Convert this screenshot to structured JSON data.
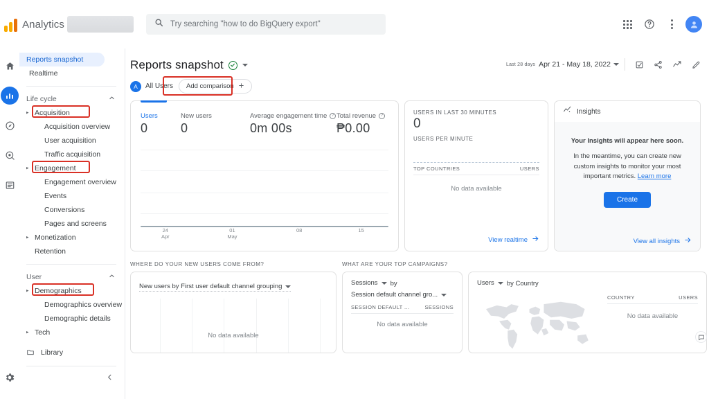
{
  "topbar": {
    "brand_name": "Analytics",
    "logo_icon": "analytics-bars-icon",
    "property_chip": "",
    "search": {
      "placeholder": "Try searching \"how to do BigQuery export\"",
      "value": "",
      "icon": "search-icon"
    },
    "icons": {
      "apps": "apps-grid-icon",
      "help": "help-circle-icon",
      "more": "kebab-menu-icon",
      "account": "account-avatar-icon"
    }
  },
  "rail": {
    "items": [
      {
        "name": "home",
        "icon": "home-icon",
        "active": false
      },
      {
        "name": "reports",
        "icon": "bar-chart-icon",
        "active": true
      },
      {
        "name": "explore",
        "icon": "explore-icon",
        "active": false
      },
      {
        "name": "advertising",
        "icon": "advertising-icon",
        "active": false
      },
      {
        "name": "configure",
        "icon": "list-icon",
        "active": false
      }
    ],
    "settings_icon": "gear-icon"
  },
  "sidebar": {
    "top_items": [
      {
        "label": "Reports snapshot",
        "selected": true
      },
      {
        "label": "Realtime",
        "selected": false
      }
    ],
    "groups": [
      {
        "title": "Life cycle",
        "collapse_icon": "chevron-up-icon",
        "items": [
          {
            "label": "Acquisition",
            "level": 1,
            "expandable": true,
            "highlighted": true
          },
          {
            "label": "Acquisition overview",
            "level": 2,
            "expandable": false,
            "highlighted": false
          },
          {
            "label": "User acquisition",
            "level": 2,
            "expandable": false,
            "highlighted": false
          },
          {
            "label": "Traffic acquisition",
            "level": 2,
            "expandable": false,
            "highlighted": false
          },
          {
            "label": "Engagement",
            "level": 1,
            "expandable": true,
            "highlighted": true
          },
          {
            "label": "Engagement overview",
            "level": 2,
            "expandable": false,
            "highlighted": false
          },
          {
            "label": "Events",
            "level": 2,
            "expandable": false,
            "highlighted": false
          },
          {
            "label": "Conversions",
            "level": 2,
            "expandable": false,
            "highlighted": false
          },
          {
            "label": "Pages and screens",
            "level": 2,
            "expandable": false,
            "highlighted": false
          },
          {
            "label": "Monetization",
            "level": 1,
            "expandable": true,
            "highlighted": false
          },
          {
            "label": "Retention",
            "level": 1,
            "expandable": false,
            "highlighted": false
          }
        ]
      },
      {
        "title": "User",
        "collapse_icon": "chevron-up-icon",
        "items": [
          {
            "label": "Demographics",
            "level": 1,
            "expandable": true,
            "highlighted": true
          },
          {
            "label": "Demographics overview",
            "level": 2,
            "expandable": false,
            "highlighted": false
          },
          {
            "label": "Demographic details",
            "level": 2,
            "expandable": false,
            "highlighted": false
          },
          {
            "label": "Tech",
            "level": 1,
            "expandable": true,
            "highlighted": false
          }
        ]
      }
    ],
    "library": {
      "label": "Library",
      "icon": "folder-icon"
    },
    "collapse_icon": "chevron-left-icon",
    "highlight_color": "#d93025"
  },
  "page": {
    "title": "Reports snapshot",
    "title_badge_icon": "check-circle-icon",
    "title_caret_icon": "chevron-down-icon",
    "segment": {
      "avatar_letter": "A",
      "label": "All Users",
      "add_comparison_label": "Add comparison",
      "add_comparison_icon": "plus-icon",
      "highlighted": true
    },
    "date_range": {
      "preset": "Last 28 days",
      "range": "Apr 21 - May 18, 2022",
      "caret_icon": "chevron-down-icon"
    },
    "header_actions": [
      {
        "name": "edit-comparison-icon",
        "icon": "compare-icon"
      },
      {
        "name": "share-icon",
        "icon": "share-icon"
      },
      {
        "name": "insights-icon",
        "icon": "trend-icon"
      },
      {
        "name": "customize-icon",
        "icon": "pencil-icon"
      }
    ]
  },
  "metrics_card": {
    "selected_tab_index": 0,
    "metrics": [
      {
        "label": "Users",
        "value": "0",
        "has_help": false,
        "selected": true
      },
      {
        "label": "New users",
        "value": "0",
        "has_help": false,
        "selected": false
      },
      {
        "label": "Average engagement time",
        "value": "0m 00s",
        "has_help": true,
        "selected": false
      },
      {
        "label": "Total revenue",
        "value": "₱0.00",
        "has_help": true,
        "selected": false
      }
    ]
  },
  "chart_data": {
    "type": "line",
    "title": "Users over time",
    "xlabel": "",
    "ylabel": "Users",
    "categories": [
      "24 Apr",
      "01 May",
      "08",
      "15"
    ],
    "x_tick_labels": [
      {
        "top": "24",
        "bottom": "Apr"
      },
      {
        "top": "01",
        "bottom": "May"
      },
      {
        "top": "08",
        "bottom": ""
      },
      {
        "top": "15",
        "bottom": ""
      }
    ],
    "series": [
      {
        "name": "Users",
        "values": [
          0,
          0,
          0,
          0
        ]
      }
    ],
    "ylim": [
      0,
      1
    ],
    "grid": true,
    "legend": "none",
    "gridline_count": 4
  },
  "realtime_card": {
    "users_label": "USERS IN LAST 30 MINUTES",
    "users_value": "0",
    "per_minute_label": "USERS PER MINUTE",
    "table": {
      "columns": [
        "TOP COUNTRIES",
        "USERS"
      ],
      "rows": [],
      "empty_text": "No data available"
    },
    "footer_link": "View realtime",
    "footer_icon": "arrow-right-icon"
  },
  "insights_card": {
    "title": "Insights",
    "title_icon": "insights-trend-icon",
    "heading": "Your Insights will appear here soon.",
    "body": "In the meantime, you can create new custom insights to monitor your most important metrics.",
    "learn_more": "Learn more",
    "create_button": "Create",
    "footer_link": "View all insights",
    "footer_icon": "arrow-right-icon",
    "accent_color": "#1a73e8"
  },
  "bottom_cards": [
    {
      "section_title": "WHERE DO YOUR NEW USERS COME FROM?",
      "dropdown": "New users by First user default channel grouping",
      "dropdown_icon": "chevron-down-icon",
      "empty_text": "No data available",
      "chart_type": "bar"
    },
    {
      "section_title": "WHAT ARE YOUR TOP CAMPAIGNS?",
      "dropdown_metric": "Sessions",
      "dropdown_by": "by",
      "dropdown_dimension": "Session default channel gro...",
      "dropdown_icon": "chevron-down-icon",
      "columns": [
        "SESSION DEFAULT ...",
        "SESSIONS"
      ],
      "empty_text": "No data available",
      "chart_type": "table"
    },
    {
      "section_title": "",
      "dropdown_metric": "Users",
      "dropdown_by": "by Country",
      "dropdown_icon": "chevron-down-icon",
      "columns": [
        "COUNTRY",
        "USERS"
      ],
      "empty_text": "No data available",
      "chart_type": "map"
    }
  ],
  "feedback_icon": "feedback-bubble-icon"
}
